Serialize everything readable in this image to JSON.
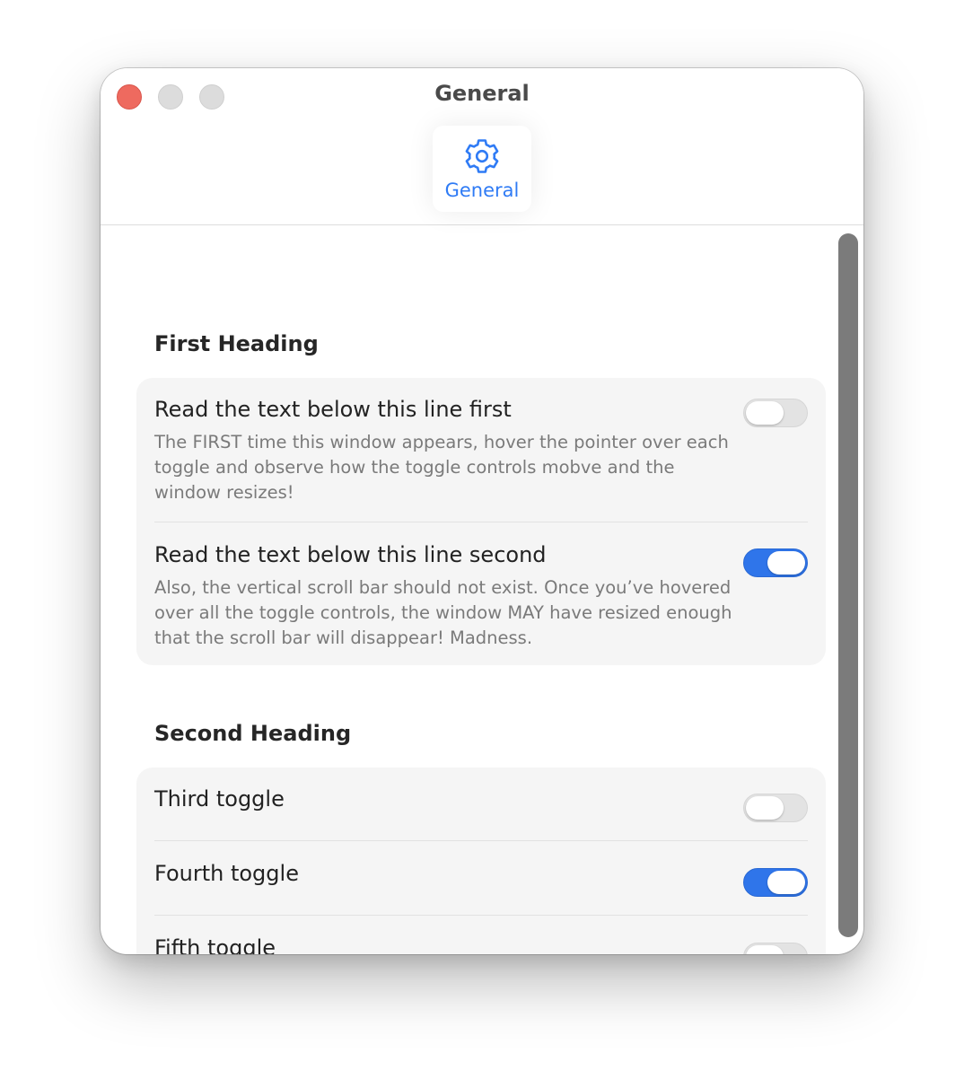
{
  "window": {
    "title": "General"
  },
  "toolbar": {
    "tab_label": "General",
    "tab_icon": "gear-icon",
    "accent_color": "#2f7bf5"
  },
  "sections": [
    {
      "heading": "First Heading",
      "rows": [
        {
          "title": "Read the text below this line first",
          "description": "The FIRST time this window appears, hover the pointer over each toggle and observe how the toggle controls mobve and the window resizes!",
          "on": false
        },
        {
          "title": "Read the text below this line second",
          "description": "Also, the vertical scroll bar should not exist. Once you’ve hovered over all the toggle controls, the window MAY have resized enough that the scroll bar will disappear! Madness.",
          "on": true
        }
      ]
    },
    {
      "heading": "Second Heading",
      "rows": [
        {
          "title": "Third toggle",
          "on": false
        },
        {
          "title": "Fourth toggle",
          "on": true
        },
        {
          "title": "Fifth toggle",
          "on": false
        }
      ]
    }
  ]
}
